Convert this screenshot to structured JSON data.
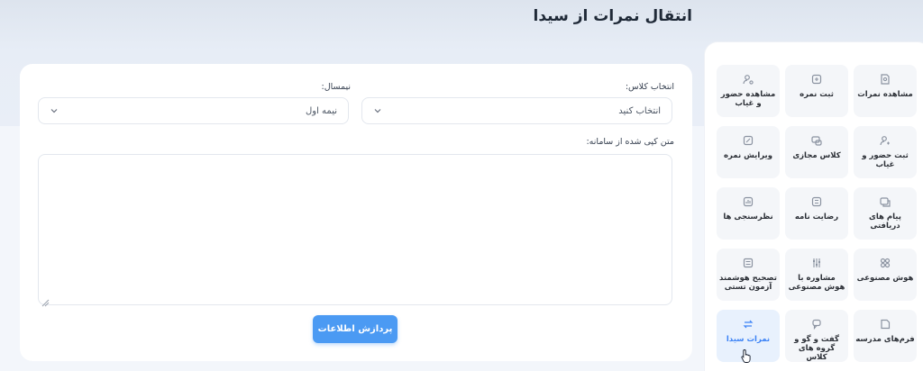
{
  "page": {
    "title": "انتقال نمرات از سیدا"
  },
  "menu": {
    "tiles": [
      {
        "label": "مشاهده نمرات",
        "icon": "grade-view-icon"
      },
      {
        "label": "ثبت نمره",
        "icon": "grade-entry-icon"
      },
      {
        "label": "مشاهده حضور و غیاب",
        "icon": "attendance-view-icon"
      },
      {
        "label": "ثبت حضور و غیاب",
        "icon": "attendance-entry-icon"
      },
      {
        "label": "کلاس مجازی",
        "icon": "virtual-class-icon"
      },
      {
        "label": "ویرایش نمره",
        "icon": "grade-edit-icon"
      },
      {
        "label": "پیام های دریافتی",
        "icon": "inbox-icon"
      },
      {
        "label": "رضایت نامه",
        "icon": "consent-form-icon"
      },
      {
        "label": "نظرسنجی ها",
        "icon": "survey-icon"
      },
      {
        "label": "هوش مصنوعی",
        "icon": "ai-icon"
      },
      {
        "label": "مشاوره با هوش مصنوعی",
        "icon": "ai-consult-icon"
      },
      {
        "label": "تصحیح هوشمند آزمون تستی",
        "icon": "smart-grading-icon"
      },
      {
        "label": "فرم‌های مدرسه",
        "icon": "school-forms-icon"
      },
      {
        "label": "گفت و گو و گروه های کلاس",
        "icon": "chat-groups-icon"
      },
      {
        "label": "نمرات سیدا",
        "icon": "sida-sync-icon",
        "active": true
      }
    ]
  },
  "form": {
    "class_label": "انتخاب کلاس:",
    "class_value": "انتخاب کنید",
    "semester_label": "نیمسال:",
    "semester_value": "نیمه اول",
    "text_label": "متن کپی شده از سامانه:",
    "text_value": "",
    "submit_label": "پردازش اطلاعات"
  },
  "colors": {
    "accent": "#4b9af3",
    "active_tile_bg": "#e8f1fd",
    "tile_bg": "#f4f6f9"
  }
}
